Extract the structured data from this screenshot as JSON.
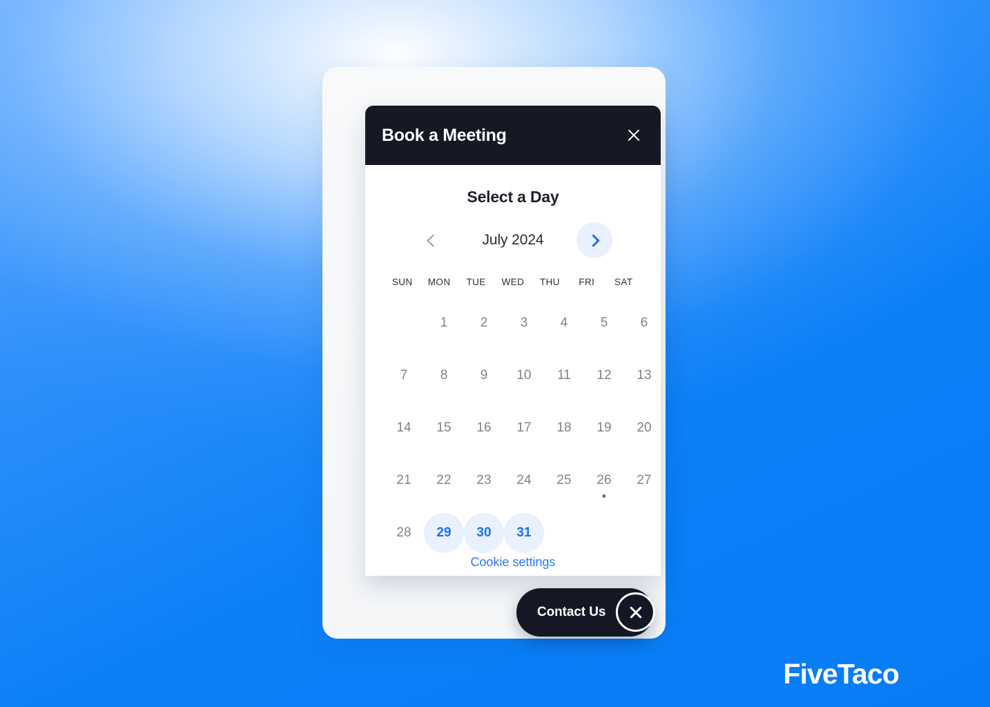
{
  "background": {
    "accent": "#0d80f7",
    "light_center": "#ffffff"
  },
  "dialog": {
    "title": "Book a Meeting",
    "close_icon": "close-icon",
    "heading": "Select a Day",
    "header_bg": "#161823"
  },
  "month_nav": {
    "prev_icon": "chevron-left-icon",
    "next_icon": "chevron-right-icon",
    "label": "July 2024",
    "prev_enabled": false,
    "next_enabled": true
  },
  "calendar": {
    "weekdays": [
      "SUN",
      "MON",
      "TUE",
      "WED",
      "THU",
      "FRI",
      "SAT"
    ],
    "accent": "#1b6fee",
    "available_bg": "#eaf1fe",
    "disabled_color": "#7e828b",
    "weeks": [
      [
        {
          "label": "",
          "state": "empty"
        },
        {
          "label": "1",
          "state": "disabled"
        },
        {
          "label": "2",
          "state": "disabled"
        },
        {
          "label": "3",
          "state": "disabled"
        },
        {
          "label": "4",
          "state": "disabled"
        },
        {
          "label": "5",
          "state": "disabled"
        },
        {
          "label": "6",
          "state": "disabled"
        }
      ],
      [
        {
          "label": "7",
          "state": "disabled"
        },
        {
          "label": "8",
          "state": "disabled"
        },
        {
          "label": "9",
          "state": "disabled"
        },
        {
          "label": "10",
          "state": "disabled"
        },
        {
          "label": "11",
          "state": "disabled"
        },
        {
          "label": "12",
          "state": "disabled"
        },
        {
          "label": "13",
          "state": "disabled"
        }
      ],
      [
        {
          "label": "14",
          "state": "disabled"
        },
        {
          "label": "15",
          "state": "disabled"
        },
        {
          "label": "16",
          "state": "disabled"
        },
        {
          "label": "17",
          "state": "disabled"
        },
        {
          "label": "18",
          "state": "disabled"
        },
        {
          "label": "19",
          "state": "disabled"
        },
        {
          "label": "20",
          "state": "disabled"
        }
      ],
      [
        {
          "label": "21",
          "state": "disabled"
        },
        {
          "label": "22",
          "state": "disabled"
        },
        {
          "label": "23",
          "state": "disabled"
        },
        {
          "label": "24",
          "state": "disabled"
        },
        {
          "label": "25",
          "state": "disabled"
        },
        {
          "label": "26",
          "state": "disabled",
          "today": true
        },
        {
          "label": "27",
          "state": "disabled"
        }
      ],
      [
        {
          "label": "28",
          "state": "disabled"
        },
        {
          "label": "29",
          "state": "available"
        },
        {
          "label": "30",
          "state": "available"
        },
        {
          "label": "31",
          "state": "available"
        },
        {
          "label": "",
          "state": "empty"
        },
        {
          "label": "",
          "state": "empty"
        },
        {
          "label": "",
          "state": "empty"
        }
      ]
    ]
  },
  "footer": {
    "cookie_settings": "Cookie settings"
  },
  "contact_widget": {
    "label": "Contact Us",
    "close_icon": "close-icon"
  },
  "brand": {
    "name": "FiveTaco"
  }
}
